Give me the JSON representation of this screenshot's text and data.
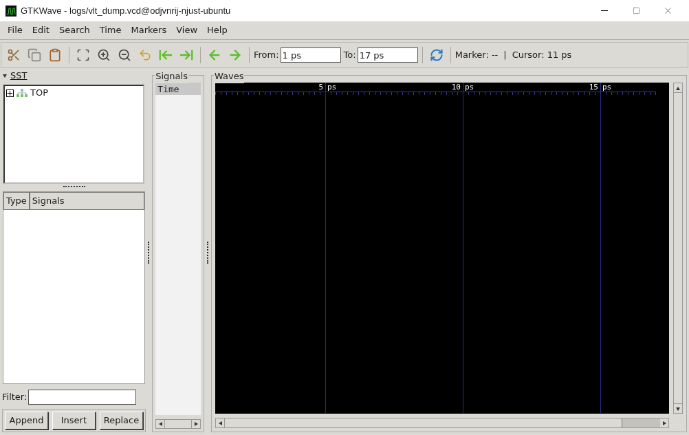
{
  "window": {
    "title": "GTKWave - logs/vlt_dump.vcd@odjvnrij-njust-ubuntu"
  },
  "menu": [
    "File",
    "Edit",
    "Search",
    "Time",
    "Markers",
    "View",
    "Help"
  ],
  "toolbar": {
    "from_label": "From:",
    "from_value": "1 ps",
    "to_label": "To:",
    "to_value": "17 ps",
    "marker": "Marker: --",
    "separator": "|",
    "cursor": "Cursor: 11 ps"
  },
  "sst": {
    "title": "SST",
    "expanded": true,
    "tree": [
      {
        "label": "TOP",
        "expanded": false
      }
    ],
    "columns": [
      "Type",
      "Signals"
    ],
    "filter_label": "Filter:",
    "buttons": [
      "Append",
      "Insert",
      "Replace"
    ]
  },
  "signals": {
    "title": "Signals",
    "items": [
      {
        "label": "Time",
        "selected": true
      }
    ]
  },
  "waves": {
    "title": "Waves",
    "ruler": [
      {
        "value": "5",
        "unit": "ps"
      },
      {
        "value": "10",
        "unit": "ps"
      },
      {
        "value": "15",
        "unit": "ps"
      }
    ]
  }
}
